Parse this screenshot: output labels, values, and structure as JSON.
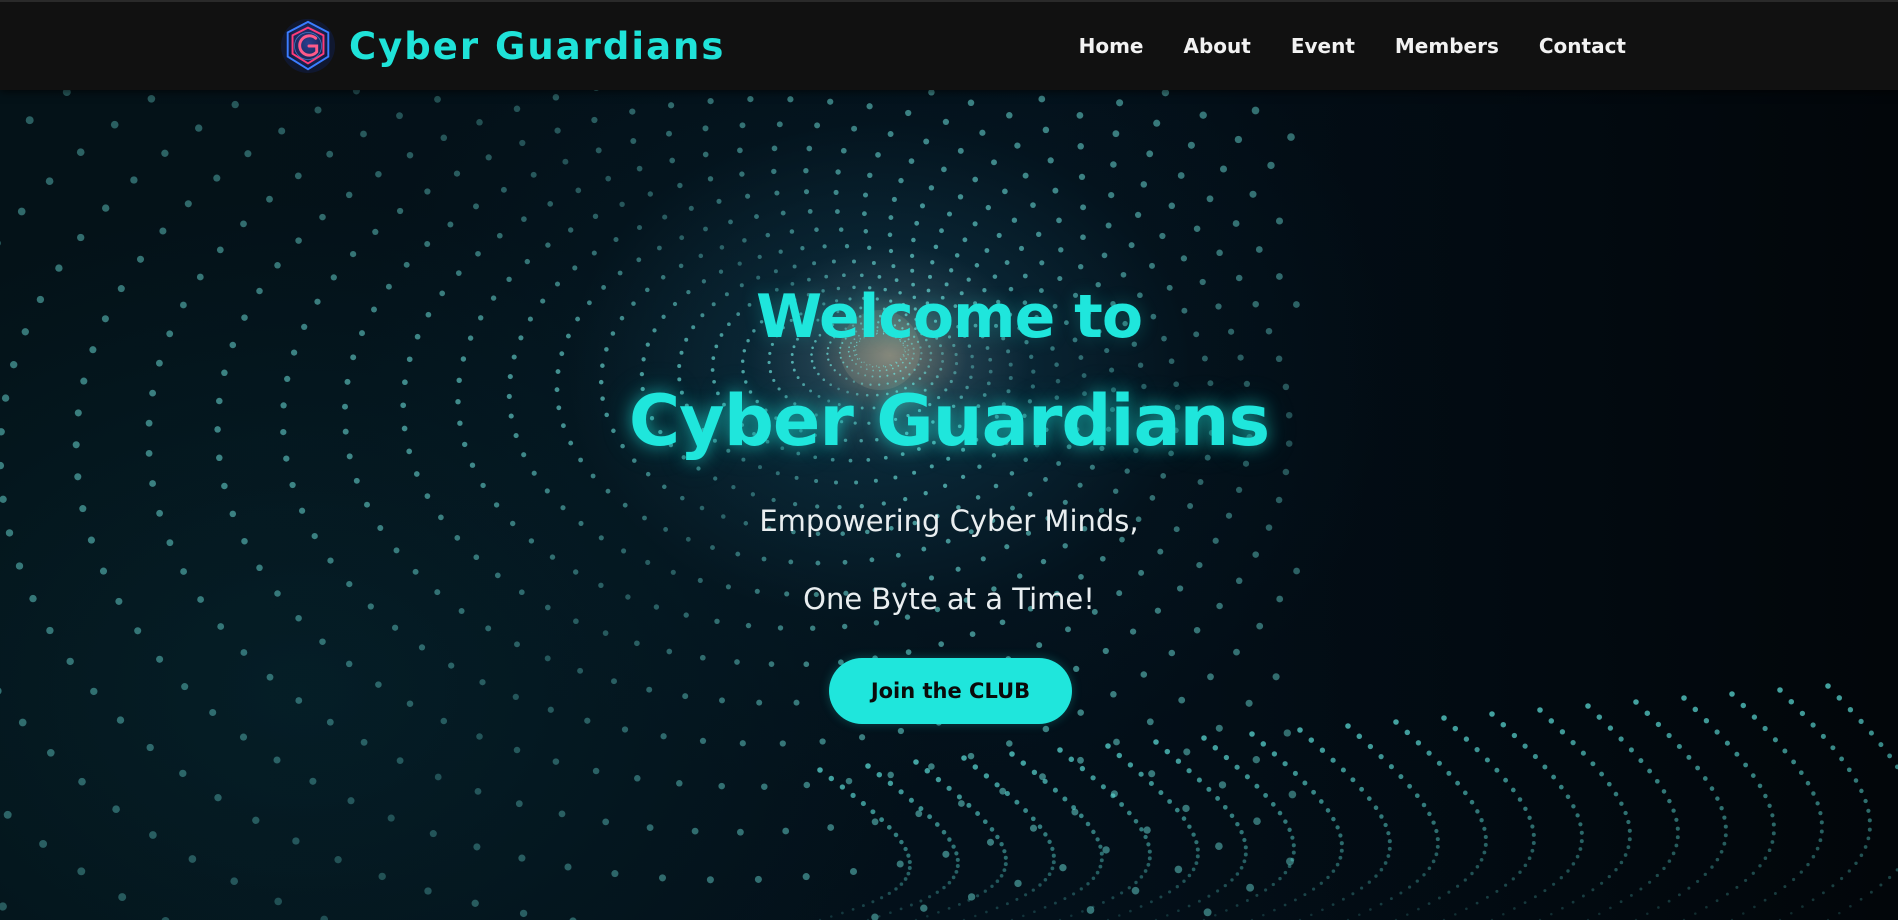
{
  "header": {
    "logo_icon": "cyber-guardians-shield-logo",
    "brand_name": "Cyber Guardians",
    "nav": [
      {
        "label": "Home"
      },
      {
        "label": "About"
      },
      {
        "label": "Event"
      },
      {
        "label": "Members"
      },
      {
        "label": "Contact"
      }
    ]
  },
  "hero": {
    "welcome": "Welcome to",
    "title": "Cyber Guardians",
    "tagline_line1": "Empowering Cyber Minds,",
    "tagline_line2": "One Byte at a Time!",
    "cta_label": "Join the CLUB"
  },
  "colors": {
    "accent": "#1fe6dc",
    "nav_background": "#111111",
    "hero_background": "#03080c",
    "nav_text": "#f2f2f2",
    "tagline_text": "#e9eef0"
  }
}
